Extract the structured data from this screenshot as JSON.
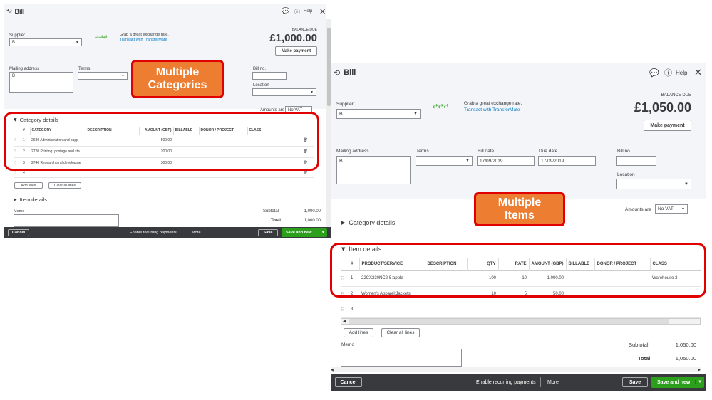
{
  "left": {
    "title": "Bill",
    "help": "Help",
    "supplier_label": "Supplier",
    "supplier_value": "B",
    "fx_line1": "Grab a great exchange rate.",
    "fx_line2": "Transact with TransferMate",
    "balance_label": "BALANCE DUE",
    "balance": "£1,000.00",
    "make_payment": "Make payment",
    "mailing_label": "Mailing address",
    "mailing_value": "B",
    "terms_label": "Terms",
    "billno_label": "Bill no.",
    "location_label": "Location",
    "amounts_label": "Amounts are",
    "amounts_value": "No VAT",
    "category_title": "Category details",
    "columns": [
      "#",
      "CATEGORY",
      "DESCRIPTION",
      "AMOUNT (GBP)",
      "BILLABLE",
      "DONOR / PROJECT",
      "CLASS"
    ],
    "rows": [
      {
        "n": "1",
        "category": "2680 Administration and supp",
        "amount": "500.00"
      },
      {
        "n": "2",
        "category": "2720 Printing, postage and sta",
        "amount": "200.00"
      },
      {
        "n": "3",
        "category": "2740 Research and developme",
        "amount": "300.00"
      },
      {
        "n": "4",
        "category": "",
        "amount": ""
      }
    ],
    "add_lines": "Add lines",
    "clear_lines": "Clear all lines",
    "item_title": "Item details",
    "memo_label": "Memo",
    "subtotal_label": "Subtotal",
    "subtotal": "1,000.00",
    "total_label": "Total",
    "total": "1,000.00",
    "cancel": "Cancel",
    "recurring": "Enable recurring payments",
    "more": "More",
    "save": "Save",
    "save_new": "Save and new"
  },
  "right": {
    "title": "Bill",
    "help": "Help",
    "supplier_label": "Supplier",
    "supplier_value": "B",
    "fx_line1": "Grab a great exchange rate.",
    "fx_line2": "Transact with TransferMate",
    "balance_label": "BALANCE DUE",
    "balance": "£1,050.00",
    "make_payment": "Make payment",
    "mailing_label": "Mailing address",
    "mailing_value": "B",
    "terms_label": "Terms",
    "bill_date_label": "Bill date",
    "bill_date": "17/09/2019",
    "due_date_label": "Due date",
    "due_date": "17/09/2019",
    "billno_label": "Bill no.",
    "location_label": "Location",
    "amounts_label": "Amounts are",
    "amounts_value": "No VAT",
    "category_title": "Category details",
    "item_title": "Item details",
    "columns": [
      "#",
      "PRODUCT/SERVICE",
      "DESCRIPTION",
      "QTY",
      "RATE",
      "AMOUNT (GBP)",
      "BILLABLE",
      "DONOR / PROJECT",
      "CLASS"
    ],
    "rows": [
      {
        "n": "1",
        "product": "22CX230NC2-5:apple",
        "qty": "100",
        "rate": "10",
        "amount": "1,000.00",
        "class": "Warehouse 2"
      },
      {
        "n": "2",
        "product": "Women's Apparel:Jackets",
        "qty": "10",
        "rate": "5",
        "amount": "50.00",
        "class": ""
      },
      {
        "n": "3",
        "product": "",
        "qty": "",
        "rate": "",
        "amount": "",
        "class": ""
      }
    ],
    "add_lines": "Add lines",
    "clear_lines": "Clear all lines",
    "memo_label": "Memo",
    "subtotal_label": "Subtotal",
    "subtotal": "1,050.00",
    "total_label": "Total",
    "total": "1,050.00",
    "cancel": "Cancel",
    "recurring": "Enable recurring payments",
    "more": "More",
    "save": "Save",
    "save_new": "Save and new"
  },
  "callouts": {
    "categories_l1": "Multiple",
    "categories_l2": "Categories",
    "items_l1": "Multiple",
    "items_l2": "Items"
  },
  "colors": {
    "callout_fill": "#ed7d31",
    "callout_border": "#e00000",
    "save_green": "#2ca01c",
    "footer_dark": "#393a3d"
  }
}
